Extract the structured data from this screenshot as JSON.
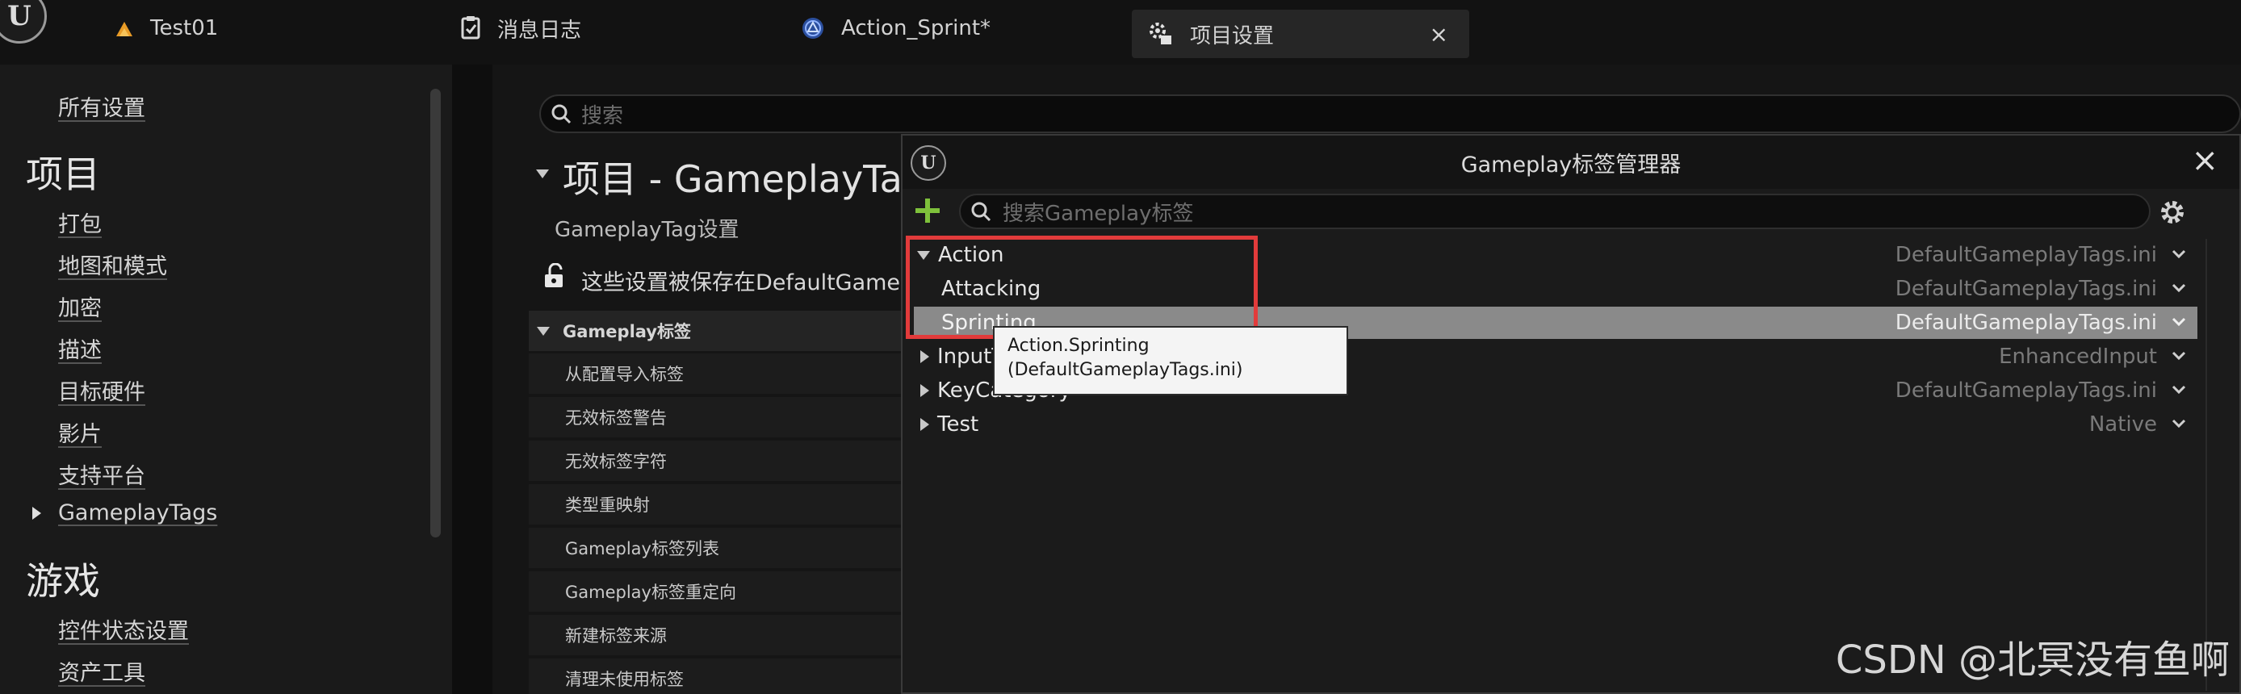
{
  "tabs": [
    {
      "label": "Test01",
      "icon": "level-icon"
    },
    {
      "label": "消息日志",
      "icon": "message-log-icon"
    },
    {
      "label": "Action_Sprint*",
      "icon": "blueprint-icon"
    },
    {
      "label": "项目设置",
      "icon": "settings-icon",
      "close": "×"
    }
  ],
  "sidebar": {
    "all_settings": "所有设置",
    "project_heading": "项目",
    "project_items": [
      "打包",
      "地图和模式",
      "加密",
      "描述",
      "目标硬件",
      "影片",
      "支持平台",
      "GameplayTags"
    ],
    "game_heading": "游戏",
    "game_items": [
      "控件状态设置",
      "资产工具"
    ]
  },
  "main": {
    "search_placeholder": "搜索",
    "title": "项目 - GameplayTags",
    "subtitle": "GameplayTag设置",
    "saved_notice": "这些设置被保存在DefaultGameplayTags.ini",
    "section_header": "Gameplay标签",
    "rows": [
      "从配置导入标签",
      "无效标签警告",
      "无效标签字符",
      "类型重映射",
      "Gameplay标签列表",
      "Gameplay标签重定向",
      "新建标签来源",
      "清理未使用标签"
    ]
  },
  "dialog": {
    "title": "Gameplay标签管理器",
    "close": "×",
    "search_placeholder": "搜索Gameplay标签",
    "tags": [
      {
        "name": "Action",
        "source": "DefaultGameplayTags.ini",
        "expanded": true,
        "depth": 0
      },
      {
        "name": "Attacking",
        "source": "DefaultGameplayTags.ini",
        "depth": 1
      },
      {
        "name": "Sprinting",
        "source": "DefaultGameplayTags.ini",
        "depth": 1,
        "selected": true
      },
      {
        "name": "InputTag",
        "source": "EnhancedInput",
        "expanded": false,
        "depth": 0
      },
      {
        "name": "KeyCategory",
        "source": "DefaultGameplayTags.ini",
        "expanded": false,
        "depth": 0
      },
      {
        "name": "Test",
        "source": "Native",
        "expanded": false,
        "depth": 0
      }
    ],
    "tooltip_line1": "Action.Sprinting",
    "tooltip_line2": "(DefaultGameplayTags.ini)"
  },
  "watermark": "CSDN @北冥没有鱼啊",
  "colors": {
    "highlight_box": "#e23b3b",
    "add_icon": "#7ec13b",
    "selection": "#8a8a8a"
  }
}
